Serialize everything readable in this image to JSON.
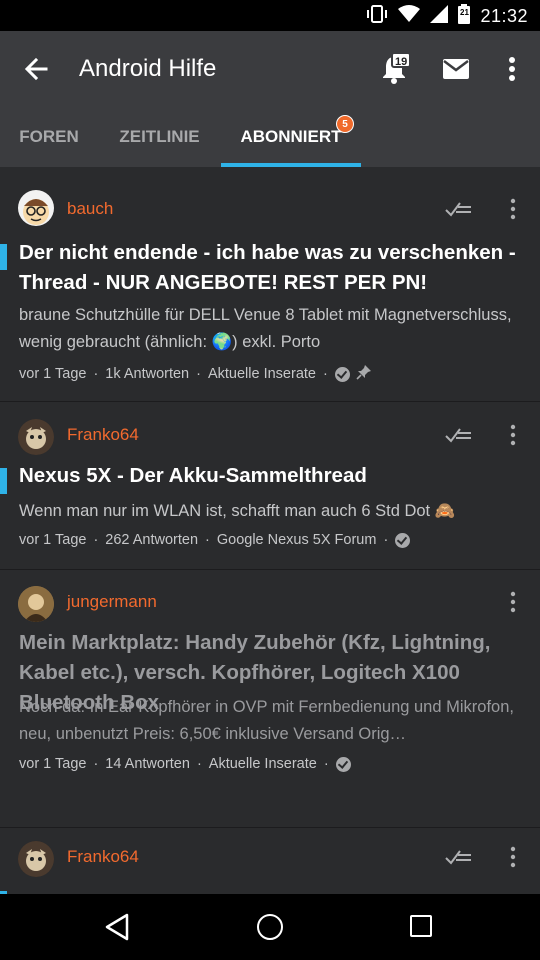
{
  "status_bar": {
    "time": "21:32",
    "calendar_day": "21",
    "icons": [
      "vibrate-icon",
      "wifi-icon",
      "signal-icon",
      "battery-icon"
    ]
  },
  "app_bar": {
    "title": "Android Hilfe",
    "notification_count": "19",
    "icons": [
      "arrow-back-icon",
      "bell-icon",
      "mail-icon",
      "more-vert-icon"
    ]
  },
  "tabs": [
    {
      "label": "FOREN",
      "active": false
    },
    {
      "label": "ZEITLINIE",
      "active": false
    },
    {
      "label": "ABONNIERT",
      "active": true,
      "badge": "5"
    }
  ],
  "colors": {
    "accent": "#2fb3e8",
    "username": "#f26a2e",
    "badge": "#f06a2b",
    "background": "#2a2b2d",
    "toolbar": "#3b3c3f"
  },
  "threads": [
    {
      "user": "bauch",
      "title": "Der nicht endende - ich habe was zu verschenken - Thread - NUR ANGEBOTE! REST PER PN!",
      "excerpt": "braune Schutzhülle für DELL Venue 8 Tablet mit Magnetverschluss, wenig gebraucht (ähnlich: 🌍) exkl. Porto",
      "age": "vor 1 Tage",
      "replies": "1k Antworten",
      "forum": "Aktuelle Inserate",
      "unread": true,
      "pinned": true
    },
    {
      "user": "Franko64",
      "title": "Nexus 5X - Der Akku-Sammelthread",
      "excerpt": "Wenn man nur im WLAN ist, schafft man auch 6 Std Dot 🙈",
      "age": "vor 1 Tage",
      "replies": "262 Antworten",
      "forum": "Google Nexus 5X Forum",
      "unread": true,
      "pinned": false
    },
    {
      "user": "jungermann",
      "title": "Mein Marktplatz: Handy Zubehör (Kfz, Lightning, Kabel etc.), versch. Kopfhörer, Logitech X100 Bluetooth Box",
      "excerpt": "Noch da: In Ear Kopfhörer in OVP mit Fernbedienung und Mikrofon, neu, unbenutzt Preis: 6,50€ inklusive Versand Orig…",
      "age": "vor 1 Tage",
      "replies": "14 Antworten",
      "forum": "Aktuelle Inserate",
      "unread": false,
      "pinned": false
    },
    {
      "user": "Franko64",
      "unread": true
    }
  ],
  "nav_bar": {
    "icons": [
      "nav-back-icon",
      "nav-home-icon",
      "nav-recents-icon"
    ]
  }
}
